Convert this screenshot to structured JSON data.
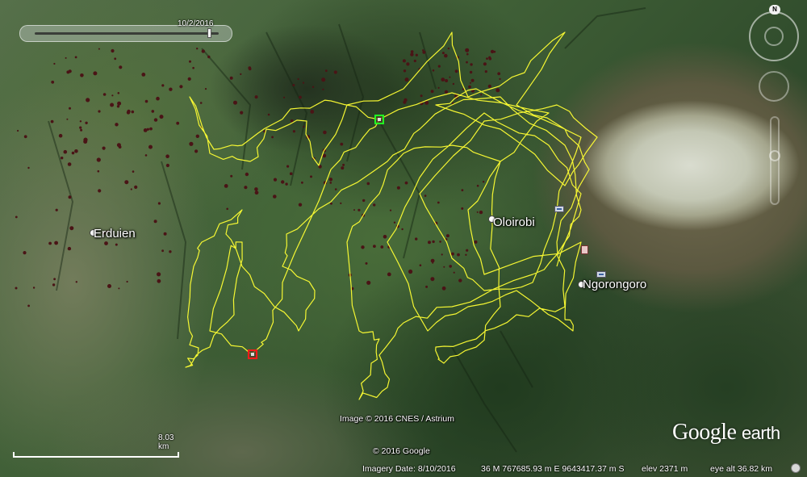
{
  "app": "Google Earth",
  "time_slider": {
    "date": "10/2/2016"
  },
  "compass": {
    "north_label": "N"
  },
  "places": {
    "erduien": "Erduien",
    "oloirobi": "Oloirobi",
    "ngorongoro": "Ngorongoro"
  },
  "scale": {
    "label": "8.03 km"
  },
  "credits": {
    "imagery": "Image © 2016 CNES / Astrium",
    "copyright": "© 2016 Google"
  },
  "logo": {
    "main": "Google",
    "suffix": "earth"
  },
  "status": {
    "imagery_date": "Imagery Date: 8/10/2016",
    "coordinates": "36 M 767685.93 m E 9643417.37 m S",
    "elevation": "elev  2371 m",
    "eye_altitude": "eye alt  36.82 km"
  },
  "track": {
    "color": "#ffff33",
    "start_marker_color": "#22ff22",
    "end_marker_color": "#ff1a1a"
  },
  "icons": [
    "compass-icon",
    "look-joystick-icon",
    "zoom-slider-icon",
    "park-icon",
    "pin-icon",
    "loading-icon"
  ]
}
